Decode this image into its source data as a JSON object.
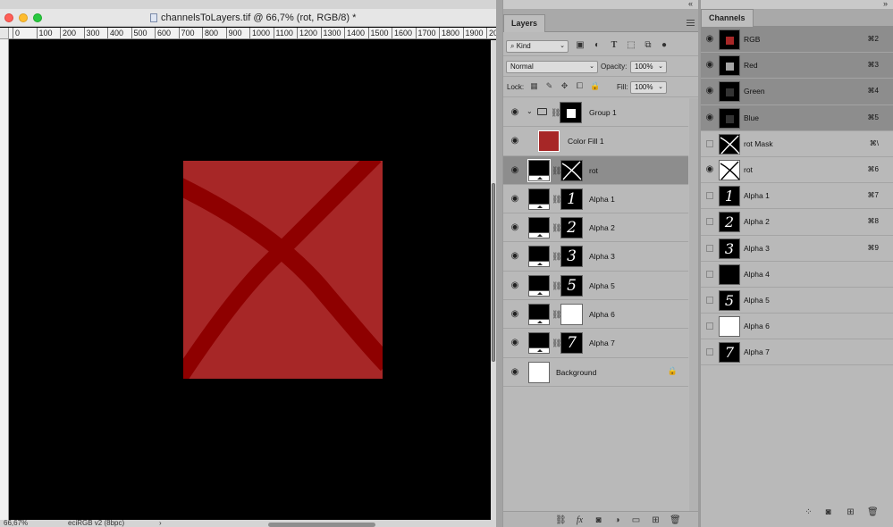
{
  "document": {
    "title": "channelsToLayers.tif @ 66,7% (rot, RGB/8) *",
    "ruler_ticks": [
      "0",
      "100",
      "200",
      "300",
      "400",
      "500",
      "600",
      "700",
      "800",
      "900",
      "1000",
      "1100",
      "1200",
      "1300",
      "1400",
      "1500",
      "1600",
      "1700",
      "1800",
      "1900",
      "20"
    ],
    "zoom": "66,67%",
    "profile": "eciRGB v2 (8bpc)",
    "status_arrow": "›",
    "art_color": "#a72727",
    "stroke_color": "#8e0000"
  },
  "layers_panel": {
    "tab": "Layers",
    "filter_kind": "Kind",
    "blend_mode": "Normal",
    "opacity_label": "Opacity:",
    "opacity_value": "100%",
    "lock_label": "Lock:",
    "fill_label": "Fill:",
    "fill_value": "100%",
    "layers": [
      {
        "name": "Group 1",
        "type": "group",
        "mask": "white-square"
      },
      {
        "name": "Color Fill 1",
        "type": "fill"
      },
      {
        "name": "rot",
        "type": "adjust",
        "mask": "x",
        "selected": true
      },
      {
        "name": "Alpha 1",
        "type": "adjust",
        "mask": "1"
      },
      {
        "name": "Alpha 2",
        "type": "adjust",
        "mask": "2"
      },
      {
        "name": "Alpha 3",
        "type": "adjust",
        "mask": "3"
      },
      {
        "name": "Alpha 5",
        "type": "adjust",
        "mask": "5"
      },
      {
        "name": "Alpha 6",
        "type": "adjust",
        "mask": "white"
      },
      {
        "name": "Alpha 7",
        "type": "adjust",
        "mask": "7"
      },
      {
        "name": "Background",
        "type": "background",
        "locked": true
      }
    ]
  },
  "channels_panel": {
    "tab": "Channels",
    "channels": [
      {
        "name": "RGB",
        "shortcut": "⌘2",
        "visible": true,
        "selected": true,
        "thumb": "rgb"
      },
      {
        "name": "Red",
        "shortcut": "⌘3",
        "visible": true,
        "selected": true,
        "thumb": "red"
      },
      {
        "name": "Green",
        "shortcut": "⌘4",
        "visible": true,
        "selected": true,
        "thumb": "dark"
      },
      {
        "name": "Blue",
        "shortcut": "⌘5",
        "visible": true,
        "selected": true,
        "thumb": "dark"
      },
      {
        "name": "rot Mask",
        "shortcut": "⌘\\",
        "visible": false,
        "selected": false,
        "thumb": "x-black"
      },
      {
        "name": "rot",
        "shortcut": "⌘6",
        "visible": true,
        "selected": false,
        "thumb": "x-white"
      },
      {
        "name": "Alpha 1",
        "shortcut": "⌘7",
        "visible": false,
        "selected": false,
        "thumb": "1"
      },
      {
        "name": "Alpha 2",
        "shortcut": "⌘8",
        "visible": false,
        "selected": false,
        "thumb": "2"
      },
      {
        "name": "Alpha 3",
        "shortcut": "⌘9",
        "visible": false,
        "selected": false,
        "thumb": "3"
      },
      {
        "name": "Alpha 4",
        "shortcut": "",
        "visible": false,
        "selected": false,
        "thumb": "black"
      },
      {
        "name": "Alpha 5",
        "shortcut": "",
        "visible": false,
        "selected": false,
        "thumb": "5"
      },
      {
        "name": "Alpha 6",
        "shortcut": "",
        "visible": false,
        "selected": false,
        "thumb": "white"
      },
      {
        "name": "Alpha 7",
        "shortcut": "",
        "visible": false,
        "selected": false,
        "thumb": "7"
      }
    ]
  }
}
